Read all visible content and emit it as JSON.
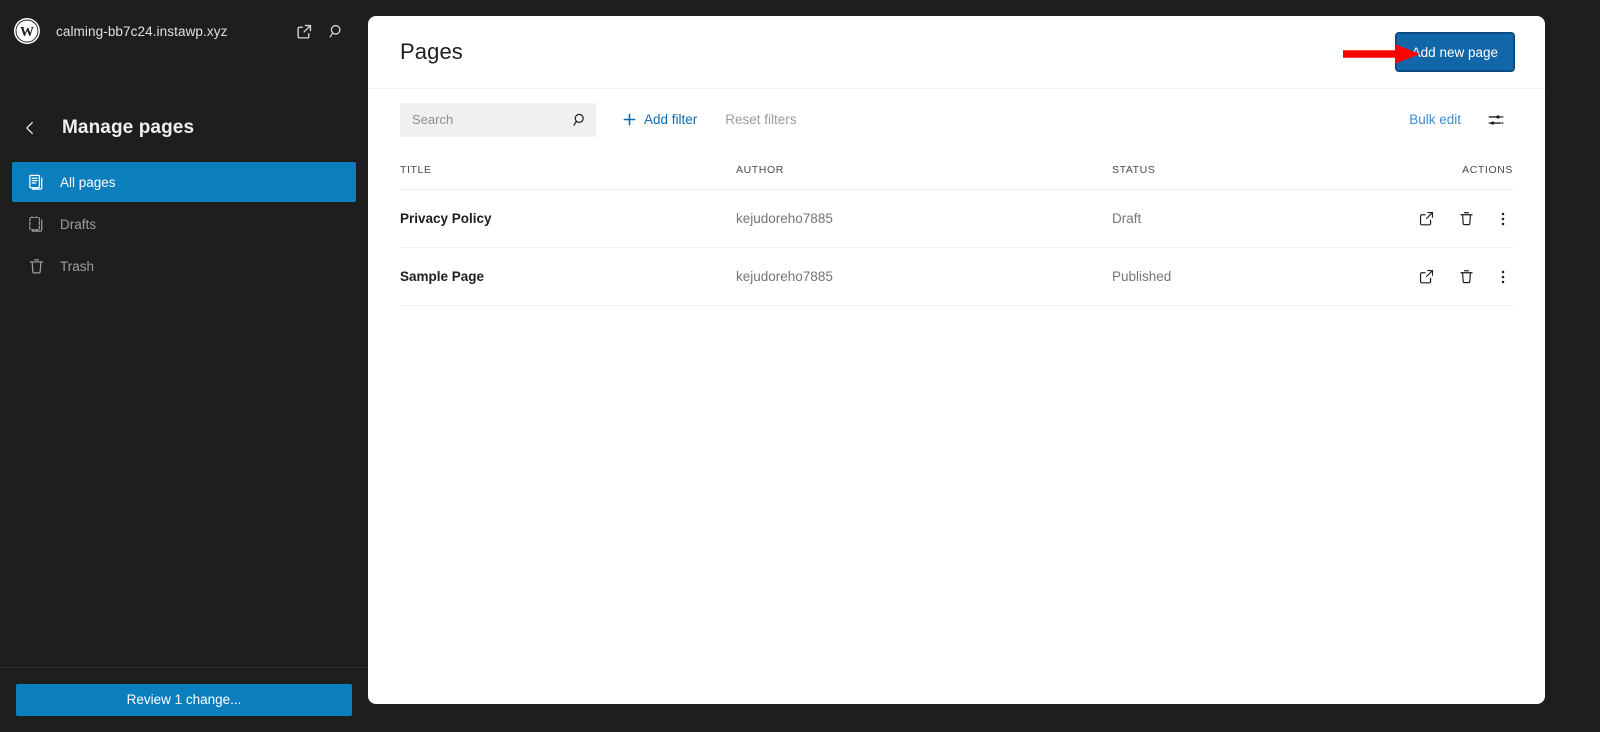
{
  "sidebar": {
    "logo_icon": "wordpress-logo-icon",
    "site_title": "calming-bb7c24.instawp.xyz",
    "open_site_icon": "external-link-icon",
    "search_icon": "search-icon",
    "back_icon": "chevron-left-icon",
    "nav_title": "Manage pages",
    "items": [
      {
        "label": "All pages",
        "icon": "pages-stack-icon",
        "active": true
      },
      {
        "label": "Drafts",
        "icon": "draft-page-icon",
        "active": false
      },
      {
        "label": "Trash",
        "icon": "trash-icon",
        "active": false
      }
    ],
    "footer": {
      "review_label": "Review 1 change...",
      "review_color": "#0b7ebd"
    }
  },
  "main": {
    "title": "Pages",
    "add_button": {
      "label": "Add new page",
      "bg_color": "#1267a8",
      "focus_ring_color": "#0b4b82"
    },
    "toolbar": {
      "search_placeholder": "Search",
      "search_value": "",
      "search_icon": "search-icon",
      "add_filter_label": "Add filter",
      "add_filter_icon": "plus-icon",
      "reset_filters_label": "Reset filters",
      "bulk_edit_label": "Bulk edit",
      "view_options_icon": "sliders-icon"
    },
    "table": {
      "columns": [
        "TITLE",
        "AUTHOR",
        "STATUS",
        "ACTIONS"
      ],
      "rows": [
        {
          "title": "Privacy Policy",
          "author": "kejudoreho7885",
          "status": "Draft",
          "actions": [
            "external-link-icon",
            "trash-icon",
            "kebab-menu-icon"
          ]
        },
        {
          "title": "Sample Page",
          "author": "kejudoreho7885",
          "status": "Published",
          "actions": [
            "external-link-icon",
            "trash-icon",
            "kebab-menu-icon"
          ]
        }
      ]
    }
  },
  "annotation": {
    "arrow_icon": "red-arrow-right-icon",
    "arrow_color": "#ff0000",
    "points_to": "Add new page"
  }
}
